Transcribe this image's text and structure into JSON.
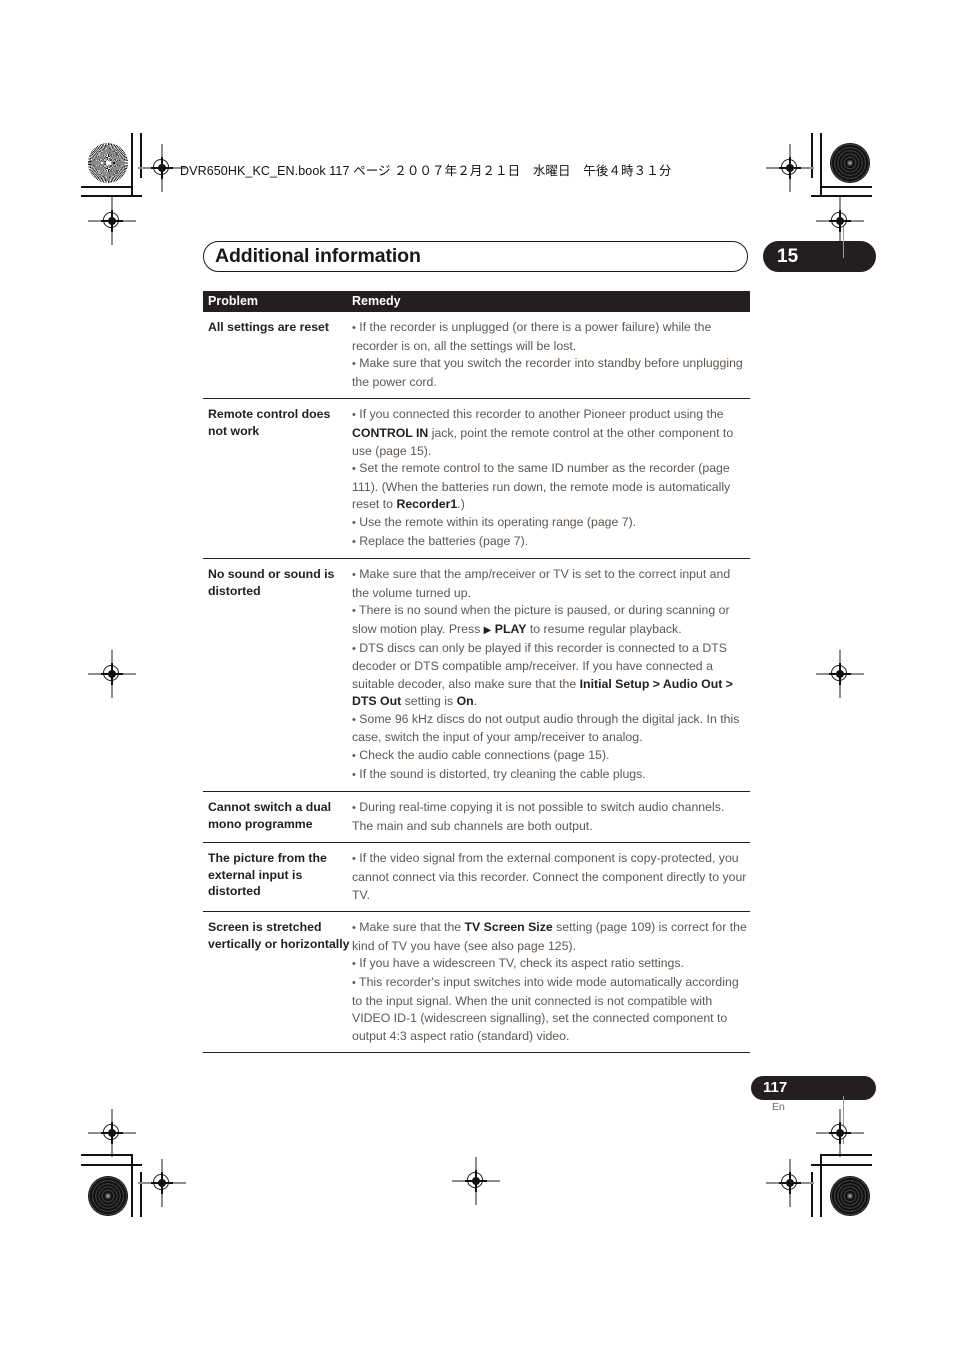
{
  "header": {
    "book_line": "DVR650HK_KC_EN.book  117 ページ  ２００７年２月２１日　水曜日　午後４時３１分"
  },
  "chapter": {
    "title": "Additional information",
    "number": "15"
  },
  "table": {
    "columns": {
      "problem": "Problem",
      "remedy": "Remedy"
    },
    "rows": [
      {
        "problem": "All settings are reset",
        "remedy_html": "<p><span class=\"bullet\">•</span> If the recorder is unplugged (or there is a power failure) while the recorder is on, all the settings will be lost.</p><p><span class=\"bullet\">•</span> Make sure that you switch the recorder into standby before unplugging the power cord.</p>"
      },
      {
        "problem": "Remote control does not work",
        "remedy_html": "<p><span class=\"bullet\">•</span> If you connected this recorder to another Pioneer product using the <b>CONTROL IN</b> jack, point the remote control at the other component to use (page 15).</p><p><span class=\"bullet\">•</span> Set the remote control to the same ID number as the recorder (page 111). (When the batteries run down, the remote mode is automatically reset to <b>Recorder1</b>.)</p><p><span class=\"bullet\">•</span> Use the remote within its operating range (page 7).</p><p><span class=\"bullet\">•</span> Replace the batteries (page 7).</p>"
      },
      {
        "problem": "No sound or sound is distorted",
        "remedy_html": "<p><span class=\"bullet\">•</span> Make sure that the amp/receiver or TV is set to the correct input and the volume turned up.</p><p><span class=\"bullet\">•</span> There is no sound when the picture is paused, or during scanning or slow motion play. Press <span class=\"play-tri\">&#9654;</span> <b>PLAY</b> to resume regular playback.</p><p><span class=\"bullet\">•</span> DTS discs can only be played if this recorder is connected to a DTS decoder or DTS compatible amp/receiver. If you have connected a suitable decoder, also make sure that the <b>Initial Setup &gt; Audio Out &gt; DTS Out</b> setting is <b>On</b>.</p><p><span class=\"bullet\">•</span> Some 96 kHz discs do not output audio through the digital jack. In this case, switch the input of your amp/receiver to analog.</p><p><span class=\"bullet\">•</span> Check the audio cable connections (page 15).</p><p><span class=\"bullet\">•</span> If the sound is distorted, try cleaning the cable plugs.</p>"
      },
      {
        "problem": "Cannot switch a dual mono programme",
        "remedy_html": "<p><span class=\"bullet\">•</span> During real-time copying it is not possible to switch audio channels. The main and sub channels are both output.</p>"
      },
      {
        "problem": "The picture from the external input is distorted",
        "remedy_html": "<p><span class=\"bullet\">•</span> If the video signal from the external component is copy-protected, you cannot connect via this recorder. Connect the component directly to your TV.</p>"
      },
      {
        "problem": "Screen is stretched vertically or horizontally",
        "remedy_html": "<p><span class=\"bullet\">•</span> Make sure that the <b>TV Screen Size</b> setting (page 109) is correct for the kind of TV you have (see also page 125).</p><p><span class=\"bullet\">•</span> If you have a widescreen TV, check its aspect ratio settings.</p><p><span class=\"bullet\">•</span> This recorder's input switches into wide mode automatically according to the input signal. When the unit connected is not compatible with VIDEO ID-1 (widescreen signalling), set the connected component to output 4:3 aspect ratio (standard) video.</p>"
      }
    ]
  },
  "footer": {
    "page_number": "117",
    "language": "En"
  },
  "colors": {
    "ink": "#231f20",
    "body_text": "#5d5854",
    "reg_mark": "#9a9a9a"
  }
}
